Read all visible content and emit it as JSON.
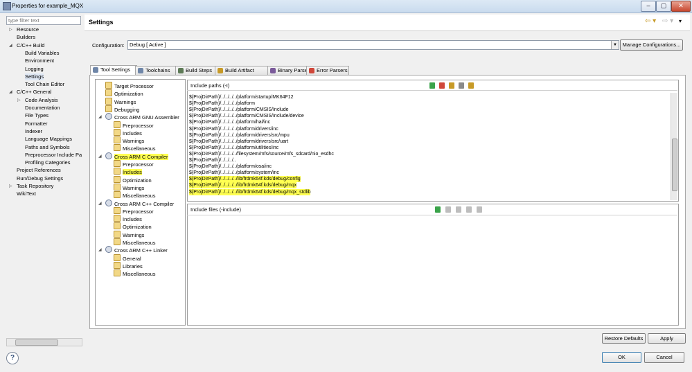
{
  "window": {
    "title": "Properties for example_MQX",
    "minimize": "–",
    "maximize": "▢",
    "close": "✕"
  },
  "filter": {
    "placeholder": "type filter text"
  },
  "nav": [
    {
      "label": "Resource",
      "arrow": "▷"
    },
    {
      "label": "Builders",
      "arrow": ""
    },
    {
      "label": "C/C++ Build",
      "arrow": "◢"
    },
    {
      "label": "Build Variables",
      "arrow": ""
    },
    {
      "label": "Environment",
      "arrow": ""
    },
    {
      "label": "Logging",
      "arrow": ""
    },
    {
      "label": "Settings",
      "arrow": ""
    },
    {
      "label": "Tool Chain Editor",
      "arrow": ""
    },
    {
      "label": "C/C++ General",
      "arrow": "◢"
    },
    {
      "label": "Code Analysis",
      "arrow": "▷"
    },
    {
      "label": "Documentation",
      "arrow": ""
    },
    {
      "label": "File Types",
      "arrow": ""
    },
    {
      "label": "Formatter",
      "arrow": ""
    },
    {
      "label": "Indexer",
      "arrow": ""
    },
    {
      "label": "Language Mappings",
      "arrow": ""
    },
    {
      "label": "Paths and Symbols",
      "arrow": ""
    },
    {
      "label": "Preprocessor Include Pa",
      "arrow": ""
    },
    {
      "label": "Profiling Categories",
      "arrow": ""
    },
    {
      "label": "Project References",
      "arrow": ""
    },
    {
      "label": "Run/Debug Settings",
      "arrow": ""
    },
    {
      "label": "Task Repository",
      "arrow": "▷"
    },
    {
      "label": "WikiText",
      "arrow": ""
    }
  ],
  "help": "?",
  "page": {
    "title": "Settings",
    "back": "⇦ ▾",
    "forward": "⇨ ▾"
  },
  "configuration": {
    "label": "Configuration:",
    "value": "Debug  [ Active ]",
    "manage": "Manage Configurations..."
  },
  "tabs": [
    "Tool Settings",
    "Toolchains",
    "Build Steps",
    "Build Artifact",
    "Binary Parsers",
    "Error Parsers"
  ],
  "tooltree": [
    {
      "label": "Target Processor",
      "level": 1
    },
    {
      "label": "Optimization",
      "level": 1
    },
    {
      "label": "Warnings",
      "level": 1
    },
    {
      "label": "Debugging",
      "level": 1
    },
    {
      "label": "Cross ARM GNU Assembler",
      "level": 0
    },
    {
      "label": "Preprocessor",
      "level": 1
    },
    {
      "label": "Includes",
      "level": 1
    },
    {
      "label": "Warnings",
      "level": 1
    },
    {
      "label": "Miscellaneous",
      "level": 1
    },
    {
      "label": "Cross ARM C Compiler",
      "level": 0
    },
    {
      "label": "Preprocessor",
      "level": 1
    },
    {
      "label": "Includes",
      "level": 1
    },
    {
      "label": "Optimization",
      "level": 1
    },
    {
      "label": "Warnings",
      "level": 1
    },
    {
      "label": "Miscellaneous",
      "level": 1
    },
    {
      "label": "Cross ARM C++ Compiler",
      "level": 0
    },
    {
      "label": "Preprocessor",
      "level": 1
    },
    {
      "label": "Includes",
      "level": 1
    },
    {
      "label": "Optimization",
      "level": 1
    },
    {
      "label": "Warnings",
      "level": 1
    },
    {
      "label": "Miscellaneous",
      "level": 1
    },
    {
      "label": "Cross ARM C++ Linker",
      "level": 0
    },
    {
      "label": "General",
      "level": 1
    },
    {
      "label": "Libraries",
      "level": 1
    },
    {
      "label": "Miscellaneous",
      "level": 1
    }
  ],
  "include_paths": {
    "title": "Include paths (-I)",
    "items": [
      "${ProjDirPath}/../../../../platform/startup/MK64F12",
      "${ProjDirPath}/../../../../platform",
      "${ProjDirPath}/../../../../platform/CMSIS/Include",
      "${ProjDirPath}/../../../../platform/CMSIS/Include/device",
      "${ProjDirPath}/../../../../platform/hal/inc",
      "${ProjDirPath}/../../../../platform/drivers/inc",
      "${ProjDirPath}/../../../../platform/drivers/src/mpu",
      "${ProjDirPath}/../../../../platform/drivers/src/uart",
      "${ProjDirPath}/../../../../platform/utilities/inc",
      "${ProjDirPath}/../../../../filesystem/mfs/source/mfs_sdcard/nio_esdhc",
      "${ProjDirPath}/../../../..",
      "${ProjDirPath}/../../../../platform/osa/inc",
      "${ProjDirPath}/../../../../platform/system/inc",
      "${ProjDirPath}/../../../../lib/frdmk64f.kds/debug/config",
      "${ProjDirPath}/../../../../lib/frdmk64f.kds/debug/mqx",
      "${ProjDirPath}/../../../../lib/frdmk64f.kds/debug/mqx_stdlib"
    ]
  },
  "include_files": {
    "title": "Include files (-include)"
  },
  "buttons": {
    "restore": "Restore Defaults",
    "apply": "Apply",
    "ok": "OK",
    "cancel": "Cancel"
  },
  "colors": {
    "highlight": "#ffff52",
    "accent_green": "#3aa34a",
    "accent_red": "#d0473a"
  }
}
